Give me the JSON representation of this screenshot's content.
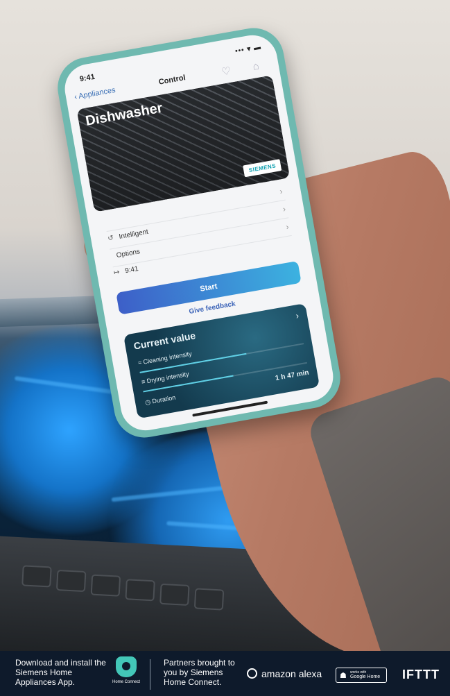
{
  "phone": {
    "time": "9:41",
    "signal": "••• ▾ ▬",
    "nav": {
      "back": "‹ Appliances",
      "title": "Control",
      "icons": "♡ ⌂"
    },
    "hero": {
      "title": "Dishwasher",
      "brand": "SIEMENS"
    },
    "rows": [
      {
        "icon": "",
        "label": ""
      },
      {
        "icon": "↺",
        "label": "Intelligent"
      },
      {
        "icon": "",
        "label": "Options"
      },
      {
        "icon": "↦",
        "label": "9:41"
      }
    ],
    "start_label": "Start",
    "feedback_label": "Give feedback",
    "card": {
      "title": "Current value",
      "rows": [
        {
          "icon": "≈",
          "label": "Cleaning intensity",
          "value": "",
          "level": 0.65
        },
        {
          "icon": "≡",
          "label": "Drying intensity",
          "value": "",
          "level": 0.55
        },
        {
          "icon": "◷",
          "label": "Duration",
          "value": "1 h 47 min",
          "level": 0
        }
      ]
    }
  },
  "footer": {
    "download_text": "Download and install the Siemens Home Appliances App.",
    "app_logo_label": "Home Connect",
    "partners_text": "Partners brought to you by Siemens Home Connect.",
    "alexa": "amazon alexa",
    "google_small": "works with",
    "google_big": "Google Home",
    "ifttt": "IFTTT"
  },
  "colors": {
    "accent": "#3d5fc8",
    "teal": "#43c7b8",
    "footer_bg": "#0e1a2b"
  }
}
